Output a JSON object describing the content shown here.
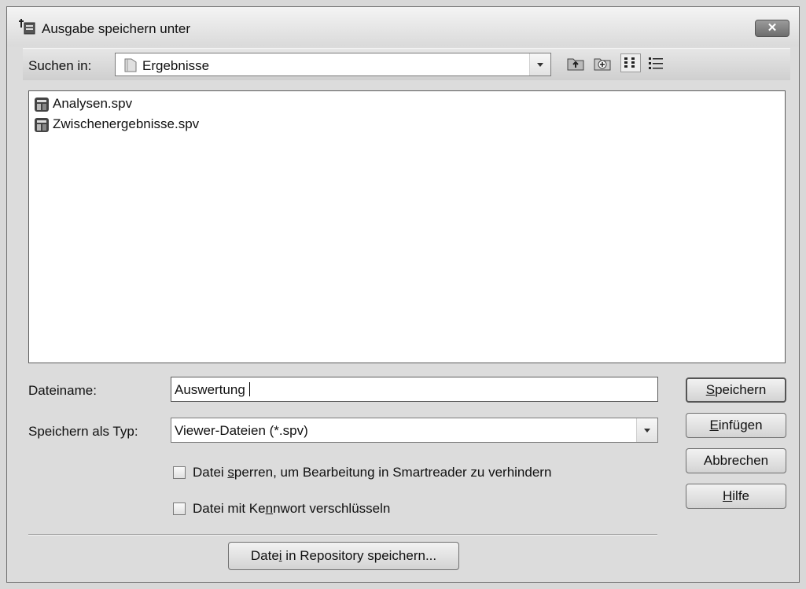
{
  "dialog": {
    "title": "Ausgabe speichern unter",
    "close_label": "✕",
    "icon": "spss-output-icon"
  },
  "lookin": {
    "label": "Suchen in:",
    "folder": "Ergebnisse",
    "toolbar_icons": [
      "up-folder-icon",
      "new-folder-icon",
      "list-view-icon",
      "details-view-icon"
    ]
  },
  "files": [
    {
      "name": "Analysen.spv",
      "icon": "spv-file-icon"
    },
    {
      "name": "Zwischenergebnisse.spv",
      "icon": "spv-file-icon"
    }
  ],
  "filename": {
    "label": "Dateiname:",
    "value": "Auswertung"
  },
  "filetype": {
    "label": "Speichern als Typ:",
    "value": "Viewer-Dateien (*.spv)"
  },
  "options": {
    "lock": {
      "pre": "Datei ",
      "accel": "s",
      "post": "perren, um Bearbeitung in Smartreader zu verhindern",
      "checked": false
    },
    "encrypt": {
      "pre": "Datei mit Ke",
      "accel": "n",
      "post": "nwort verschlüsseln",
      "checked": false
    }
  },
  "buttons": {
    "save": {
      "accel": "S",
      "rest": "peichern"
    },
    "paste": {
      "accel": "E",
      "rest": "infügen"
    },
    "cancel": {
      "label": "Abbrechen"
    },
    "help": {
      "accel": "H",
      "rest": "ilfe"
    },
    "repository": {
      "pre": "Date",
      "accel": "i",
      "post": " in Repository speichern..."
    }
  }
}
